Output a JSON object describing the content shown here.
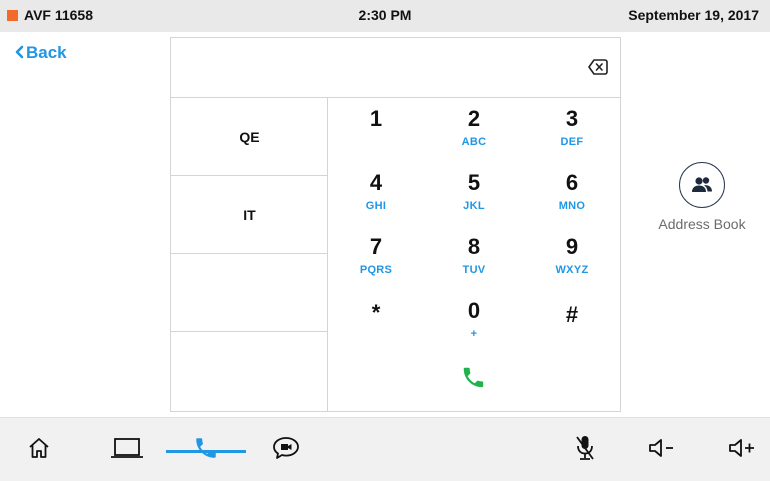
{
  "status": {
    "room": "AVF 11658",
    "time": "2:30 PM",
    "date": "September 19, 2017",
    "indicator_color": "#f26b2a"
  },
  "back": {
    "label": "Back"
  },
  "dialer": {
    "number": "",
    "shortcuts": [
      "QE",
      "IT",
      "",
      ""
    ],
    "keys": [
      {
        "digit": "1",
        "letters": ""
      },
      {
        "digit": "2",
        "letters": "ABC"
      },
      {
        "digit": "3",
        "letters": "DEF"
      },
      {
        "digit": "4",
        "letters": "GHI"
      },
      {
        "digit": "5",
        "letters": "JKL"
      },
      {
        "digit": "6",
        "letters": "MNO"
      },
      {
        "digit": "7",
        "letters": "PQRS"
      },
      {
        "digit": "8",
        "letters": "TUV"
      },
      {
        "digit": "9",
        "letters": "WXYZ"
      },
      {
        "digit": "*",
        "letters": ""
      },
      {
        "digit": "0",
        "letters": "+"
      },
      {
        "digit": "#",
        "letters": ""
      }
    ],
    "call_icon": "phone-icon",
    "call_color": "#21b24b"
  },
  "address_book": {
    "label": "Address Book",
    "icon": "contacts-icon"
  },
  "bottom_nav": {
    "items": [
      "home-icon",
      "laptop-icon",
      "phone-icon",
      "chat-video-icon",
      "mic-muted-icon",
      "volume-down-icon",
      "volume-up-icon"
    ],
    "active": "phone-icon",
    "accent": "#1f97e5"
  }
}
